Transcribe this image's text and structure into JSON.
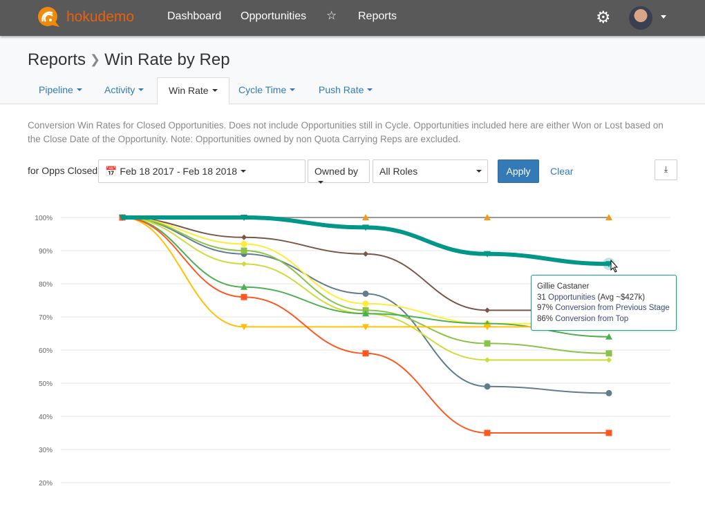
{
  "nav": {
    "brand": "hokudemo",
    "links": [
      "Dashboard",
      "Opportunities",
      "Reports"
    ],
    "star_icon": "star-icon",
    "settings_icon": "gear-icon"
  },
  "page": {
    "crumb_root": "Reports",
    "crumb_current": "Win Rate by Rep"
  },
  "tabs": [
    {
      "label": "Pipeline"
    },
    {
      "label": "Activity"
    },
    {
      "label": "Win Rate",
      "active": true
    },
    {
      "label": "Cycle Time"
    },
    {
      "label": "Push Rate"
    }
  ],
  "description": "Conversion Win Rates for Closed Opportunities. Does not include Opportunities still in Cycle. Opportunities included here are either Won or Lost based on the Close Date of the Opportunity. Note: Opportunities owned by non Quota Carrying Reps are excluded.",
  "filters": {
    "label": "for Opps Closed",
    "date_range": "Feb 18 2017 - Feb 18 2018",
    "owned_by": "Owned by",
    "roles": "All Roles",
    "apply": "Apply",
    "clear": "Clear"
  },
  "tooltip": {
    "name": "Gillie Castaner",
    "count": "31",
    "count_text": "Opportunities",
    "avg": "(Avg ~$427k)",
    "prev_pct": "97%",
    "prev_text": "Conversion from Previous Stage",
    "top_pct": "86%",
    "top_text": "Conversion from Top"
  },
  "chart_data": {
    "type": "line",
    "y_ticks": [
      "100%",
      "90%",
      "80%",
      "70%",
      "60%",
      "50%",
      "40%",
      "30%",
      "20%"
    ],
    "ylim": [
      20,
      100
    ],
    "grid": true,
    "x": [
      1,
      2,
      3,
      4,
      5
    ],
    "series": [
      {
        "color": "#f39c12",
        "marker": "triangle",
        "values": [
          100,
          100,
          100,
          100,
          100
        ]
      },
      {
        "color": "#795548",
        "marker": "diamond",
        "values": [
          100,
          94,
          89,
          72,
          72
        ]
      },
      {
        "color": "#607d8b",
        "marker": "circle",
        "values": [
          100,
          89,
          77,
          49,
          47
        ]
      },
      {
        "color": "#ffeb3b",
        "marker": "circle",
        "values": [
          100,
          92,
          74,
          68,
          68
        ]
      },
      {
        "color": "#8bc34a",
        "marker": "square",
        "values": [
          100,
          90,
          72,
          62,
          59
        ]
      },
      {
        "color": "#cddc39",
        "marker": "diamond",
        "values": [
          100,
          86,
          71,
          57,
          57
        ]
      },
      {
        "color": "#4caf50",
        "marker": "triangle",
        "values": [
          100,
          79,
          71,
          68,
          64
        ]
      },
      {
        "color": "#ffc107",
        "marker": "triangle-down",
        "values": [
          100,
          67,
          67,
          67,
          67
        ]
      },
      {
        "color": "#ff5722",
        "marker": "square",
        "values": [
          100,
          76,
          59,
          35,
          35
        ]
      },
      {
        "color": "#009688",
        "marker": "triangle-down",
        "values": [
          100,
          100,
          97,
          89,
          86
        ],
        "highlighted": true
      }
    ]
  }
}
